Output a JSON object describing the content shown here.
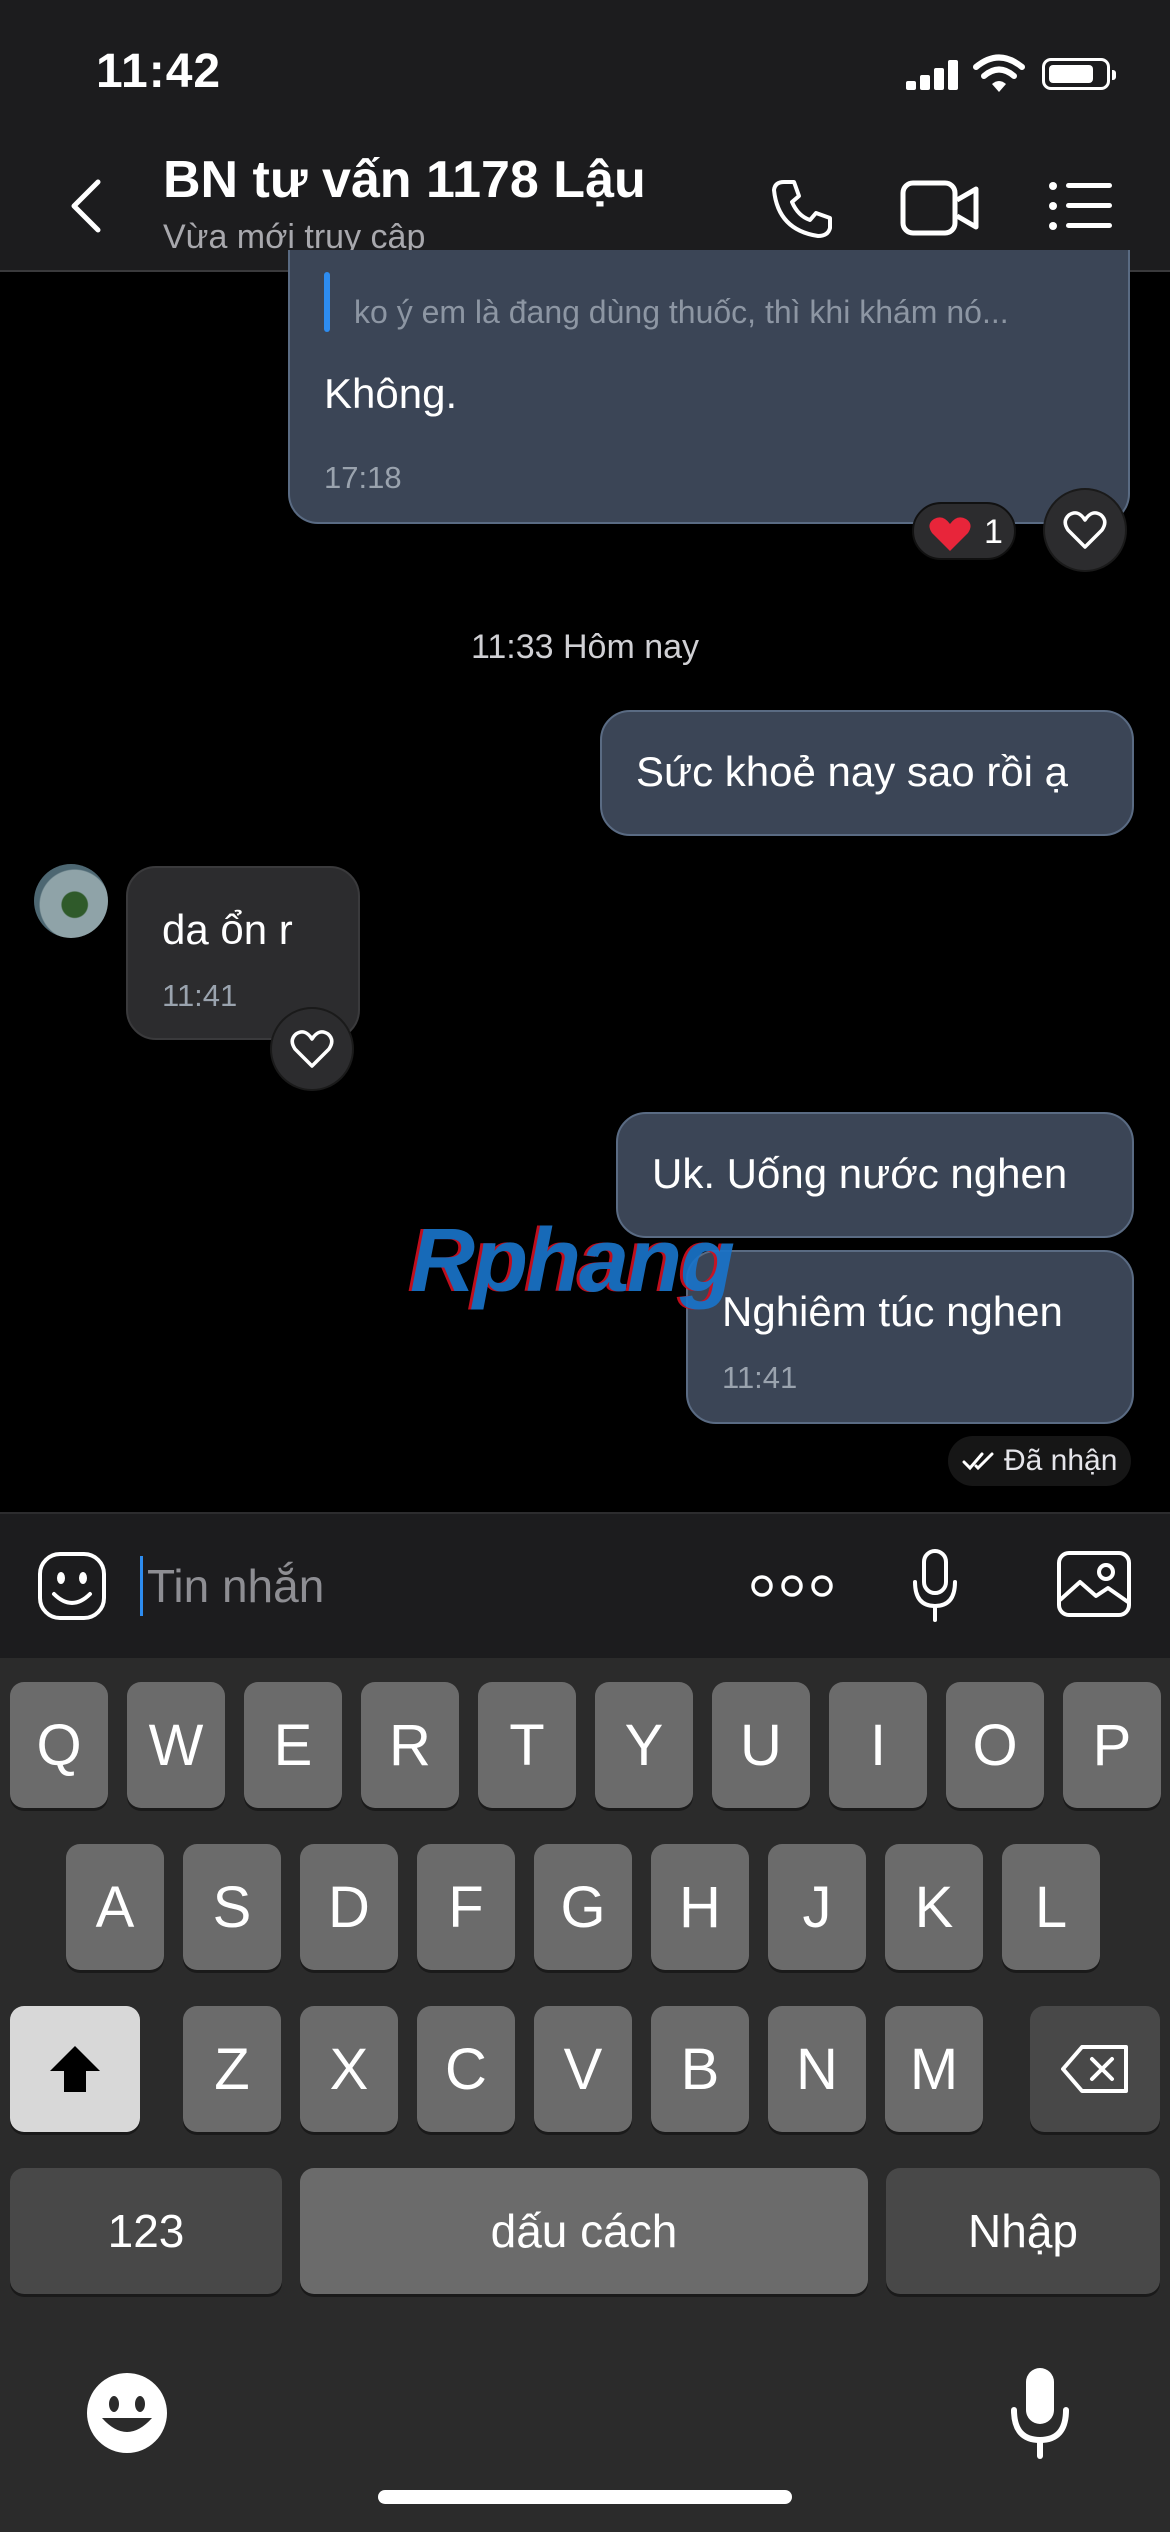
{
  "status_bar": {
    "time": "11:42"
  },
  "header": {
    "title": "BN tư vấn 1178 Lậu",
    "subtitle": "Vừa mới truy cập",
    "icons": [
      "back-chevron-icon",
      "phone-icon",
      "video-call-icon",
      "menu-list-icon"
    ]
  },
  "messages": {
    "quoted_reply": {
      "quote": "ko ý em là đang dùng thuốc, thì khi khám nó...",
      "text": "Không.",
      "time": "17:18",
      "reaction": {
        "emoji": "❤️",
        "count": "1"
      }
    },
    "date_separator": "11:33 Hôm nay",
    "out_1": {
      "text": "Sức khoẻ nay sao rồi ạ"
    },
    "in_1": {
      "text": "da ổn r",
      "time": "11:41"
    },
    "out_2": {
      "text": "Uk. Uống nước nghen"
    },
    "out_3": {
      "text": "Nghiêm túc nghen",
      "time": "11:41"
    },
    "delivery_status": "Đã nhận"
  },
  "watermark": "Rphang",
  "input_bar": {
    "placeholder": "Tin nhắn",
    "icons": [
      "sticker-face-icon",
      "more-dots-icon",
      "microphone-icon",
      "image-icon"
    ]
  },
  "keyboard": {
    "row1": [
      "Q",
      "W",
      "E",
      "R",
      "T",
      "Y",
      "U",
      "I",
      "O",
      "P"
    ],
    "row2": [
      "A",
      "S",
      "D",
      "F",
      "G",
      "H",
      "J",
      "K",
      "L"
    ],
    "row3": [
      "Z",
      "X",
      "C",
      "V",
      "B",
      "N",
      "M"
    ],
    "numbers_key": "123",
    "space_key": "dấu cách",
    "return_key": "Nhập"
  },
  "colors": {
    "outgoing_bubble": "#3b4556",
    "incoming_bubble": "#2c2c2e",
    "accent": "#2d8cf0",
    "reaction_heart": "#e8253a"
  }
}
